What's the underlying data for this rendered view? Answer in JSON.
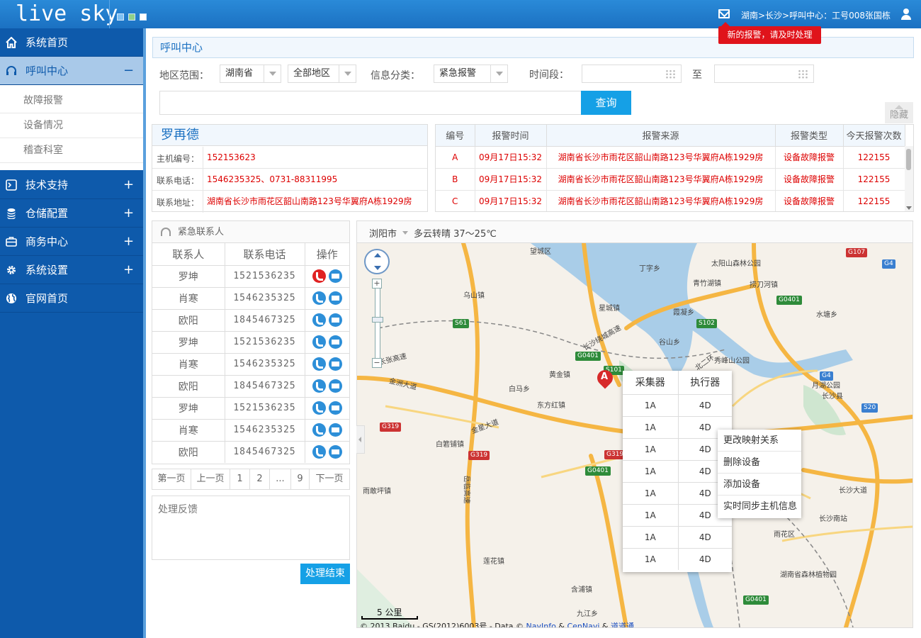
{
  "app": {
    "logo": "live sky"
  },
  "header": {
    "location": "湖南>长沙>呼叫中心：工号008张国栋",
    "alert": "新的报警，请及时处理"
  },
  "sidebar": {
    "items": [
      {
        "label": "系统首页",
        "icon": "home-icon",
        "expand": ""
      },
      {
        "label": "呼叫中心",
        "icon": "headset-icon",
        "expand": "−"
      },
      {
        "label": "技术支持",
        "icon": "terminal-icon",
        "expand": "+"
      },
      {
        "label": "仓储配置",
        "icon": "database-icon",
        "expand": "+"
      },
      {
        "label": "商务中心",
        "icon": "briefcase-icon",
        "expand": "+"
      },
      {
        "label": "系统设置",
        "icon": "gear-icon",
        "expand": "+"
      },
      {
        "label": "官网首页",
        "icon": "globe-icon",
        "expand": ""
      }
    ],
    "sub_items": [
      "故障报警",
      "设备情况",
      "稽查科室"
    ]
  },
  "panel": {
    "title": "呼叫中心"
  },
  "filters": {
    "region_label": "地区范围：",
    "province": "湖南省",
    "area": "全部地区",
    "category_label": "信息分类：",
    "category": "紧急报警",
    "time_label": "时间段：",
    "to_label": "至",
    "query_button": "查询",
    "hide_button": "隐藏"
  },
  "person": {
    "name": "罗再德",
    "host_label": "主机编号：",
    "host_value": "152153623",
    "phone_label": "联系电话：",
    "phone_value": "1546235325、0731-88311995",
    "address_label": "联系地址：",
    "address_value": "湖南省长沙市雨花区韶山南路123号华翼府A栋1929房"
  },
  "alarms": {
    "headers": [
      "编号",
      "报警时间",
      "报警来源",
      "报警类型",
      "今天报警次数"
    ],
    "rows": [
      [
        "A",
        "09月17日15:32",
        "湖南省长沙市雨花区韶山南路123号华翼府A栋1929房",
        "设备故障报警",
        "122155"
      ],
      [
        "B",
        "09月17日15:32",
        "湖南省长沙市雨花区韶山南路123号华翼府A栋1929房",
        "设备故障报警",
        "122155"
      ],
      [
        "C",
        "09月17日15:32",
        "湖南省长沙市雨花区韶山南路123号华翼府A栋1929房",
        "设备故障报警",
        "122155"
      ]
    ]
  },
  "contacts": {
    "title": "紧急联系人",
    "headers": [
      "联系人",
      "联系电话",
      "操作"
    ],
    "rows": [
      [
        "罗坤",
        "1521536235"
      ],
      [
        "肖寒",
        "1546235325"
      ],
      [
        "欧阳",
        "1845467325"
      ],
      [
        "罗坤",
        "1521536235"
      ],
      [
        "肖寒",
        "1546235325"
      ],
      [
        "欧阳",
        "1845467325"
      ],
      [
        "罗坤",
        "1521536235"
      ],
      [
        "肖寒",
        "1546235325"
      ],
      [
        "欧阳",
        "1845467325"
      ]
    ]
  },
  "pager": [
    "第一页",
    "上一页",
    "1",
    "2",
    "...",
    "9",
    "下一页"
  ],
  "feedback": {
    "placeholder": "处理反馈",
    "finish_button": "处理结束"
  },
  "map": {
    "city": "浏阳市",
    "weather": "多云转晴 37～25℃",
    "marker_label": "A",
    "scale": "5 公里",
    "copyright_prefix": "© 2013 Baidu - GS(2012)6003号 - Data © ",
    "copyright_l1": "NavInfo",
    "copyright_amp1": " & ",
    "copyright_l2": "CenNavi",
    "copyright_amp2": " & ",
    "copyright_l3": "道道通",
    "places": [
      "望城区",
      "丁字乡",
      "太阳山森林公园",
      "青竹湖镇",
      "捞刀河镇",
      "乌山镇",
      "星城镇",
      "霞凝乡",
      "水塘乡",
      "谷山乡",
      "秀峰山公园",
      "黄金镇",
      "白马乡",
      "东方红镇",
      "月湖公园",
      "长沙县",
      "白箬铺镇",
      "雨敢坪镇",
      "莲花镇",
      "含浦镇",
      "九江乡",
      "长沙南站",
      "湖南省森林植物园",
      "长张高速",
      "金洲大道",
      "长沙绕城高速",
      "金星大道",
      "长沙大道",
      "岳临高速",
      "雨花区",
      "北二环"
    ],
    "shields": [
      "G107",
      "G4",
      "S61",
      "G0401",
      "S102",
      "G0401",
      "S101",
      "G319",
      "G319",
      "S20",
      "G0401",
      "G319",
      "G4",
      "G0401"
    ],
    "popup": {
      "headers": [
        "采集器",
        "执行器"
      ],
      "rows": [
        [
          "1A",
          "4D"
        ],
        [
          "1A",
          "4D"
        ],
        [
          "1A",
          "4D"
        ],
        [
          "1A",
          "4D"
        ],
        [
          "1A",
          "4D"
        ],
        [
          "1A",
          "4D"
        ],
        [
          "1A",
          "4D"
        ],
        [
          "1A",
          "4D"
        ]
      ]
    },
    "context_menu": [
      "更改映射关系",
      "删除设备",
      "添加设备",
      "实时同步主机信息"
    ]
  }
}
